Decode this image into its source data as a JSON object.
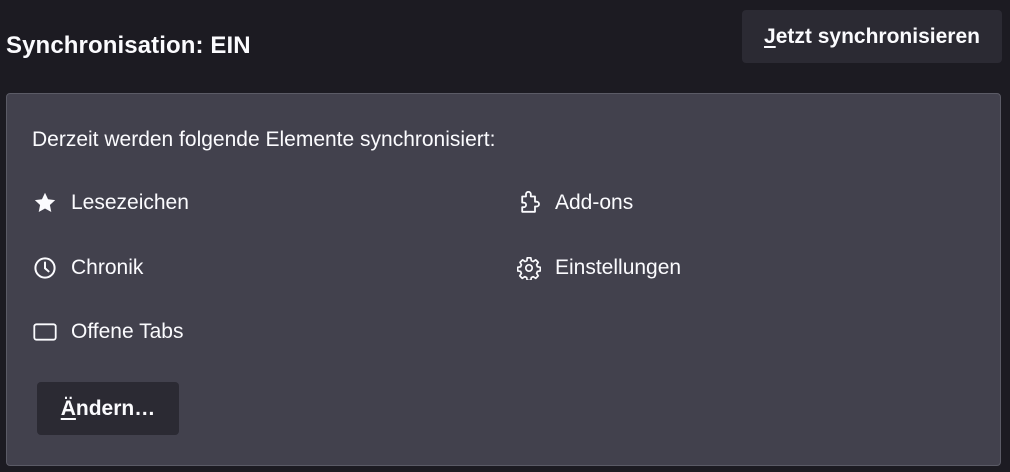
{
  "header": {
    "title": "Synchronisation: EIN",
    "sync_button": {
      "access_key": "J",
      "rest": "etzt synchronisieren"
    }
  },
  "panel": {
    "description": "Derzeit werden folgende Elemente synchronisiert:",
    "items": [
      {
        "label": "Lesezeichen",
        "icon": "star-icon"
      },
      {
        "label": "Chronik",
        "icon": "clock-icon"
      },
      {
        "label": "Offene Tabs",
        "icon": "tab-icon"
      },
      {
        "label": "Add-ons",
        "icon": "puzzle-icon"
      },
      {
        "label": "Einstellungen",
        "icon": "gear-icon"
      }
    ],
    "change_button": {
      "access_key": "Ä",
      "rest": "ndern…"
    }
  },
  "colors": {
    "background": "#1c1b22",
    "panel": "#42414d",
    "button": "#2b2a33",
    "text": "#fbfbfe"
  }
}
